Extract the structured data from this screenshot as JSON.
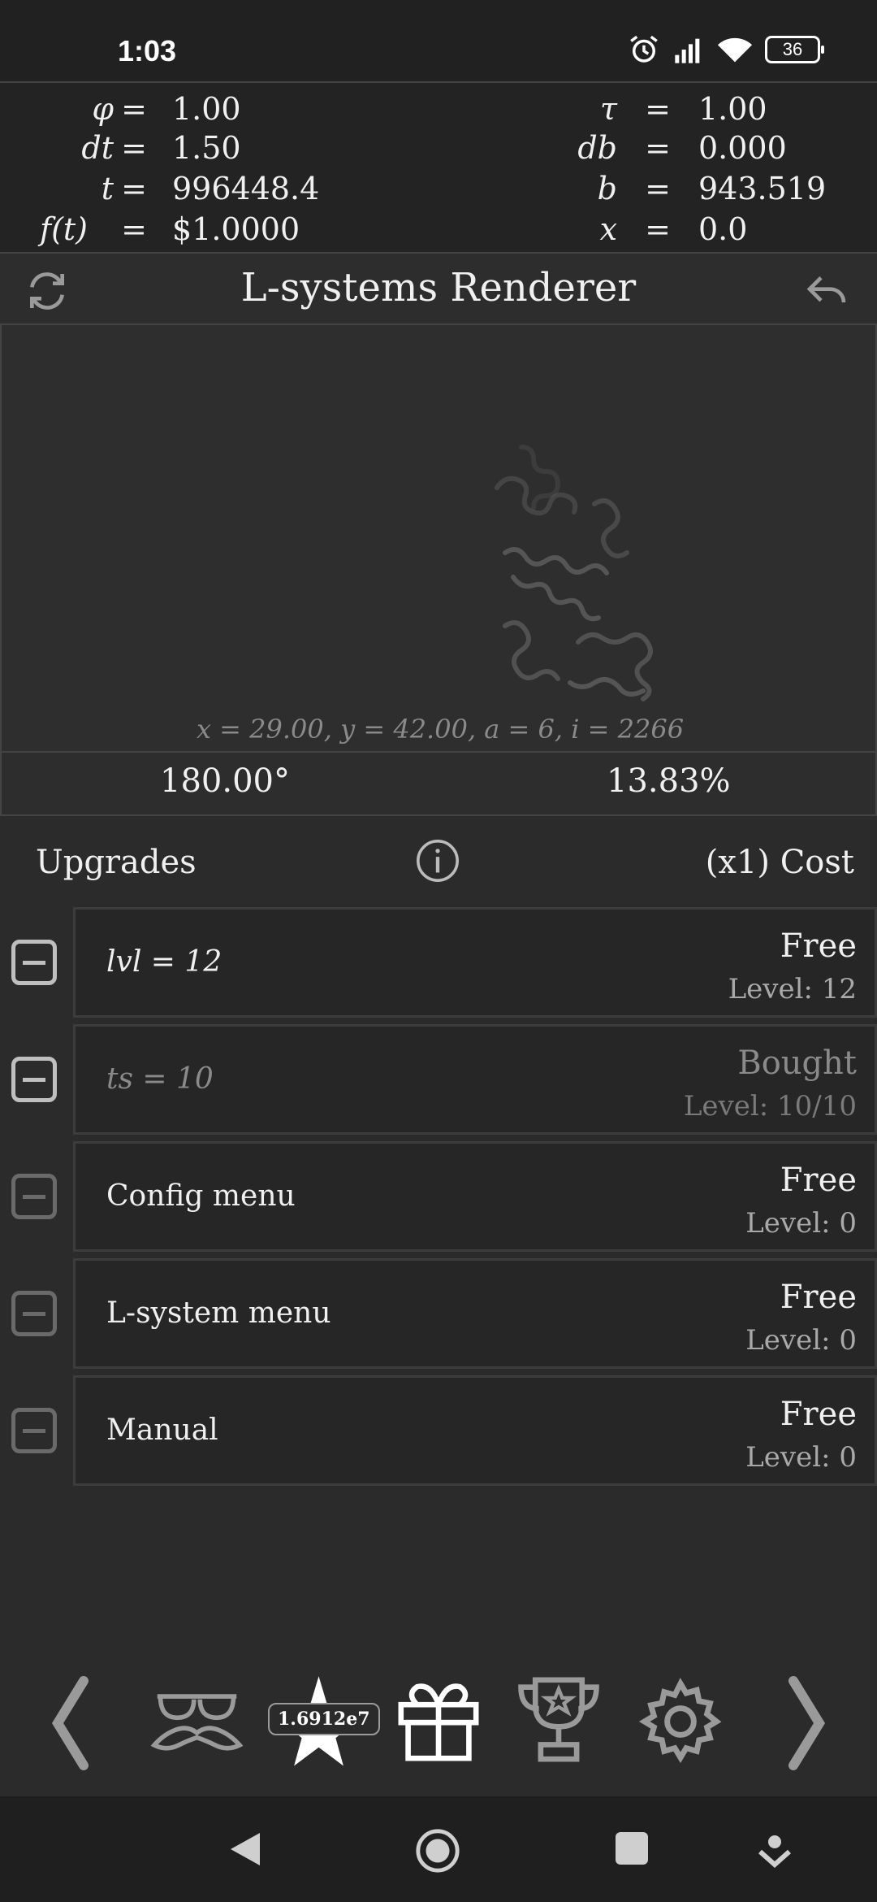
{
  "status_bar": {
    "time": "1:03",
    "battery": "36",
    "icons": [
      "alarm-icon",
      "signal-icon",
      "wifi-icon",
      "battery-icon"
    ]
  },
  "variables": {
    "left": [
      {
        "name": "φ",
        "value": "1.00"
      },
      {
        "name": "dt",
        "value": "1.50"
      },
      {
        "name": "t",
        "value": "996448.4"
      },
      {
        "name": "f(t)",
        "value": "$1.0000"
      }
    ],
    "right": [
      {
        "name": "τ",
        "value": "1.00"
      },
      {
        "name": "db",
        "value": "0.000"
      },
      {
        "name": "b",
        "value": "943.519"
      },
      {
        "name": "x",
        "value": "0.0"
      }
    ],
    "equals": "="
  },
  "title_bar": {
    "title": "L-systems Renderer",
    "left_icon": "refresh-icon",
    "right_icon": "undo-icon"
  },
  "canvas": {
    "coords": "x = 29.00,   y = 42.00,   a = 6,   i = 2266"
  },
  "info_strip": {
    "angle": "180.00°",
    "progress": "13.83%"
  },
  "upgrades_header": {
    "label": "Upgrades",
    "cost_label": "(x1) Cost",
    "info_icon": "info-icon"
  },
  "upgrades": [
    {
      "title": "lvl = 12",
      "cost": "Free",
      "level": "Level: 12"
    },
    {
      "title": "ts = 10",
      "cost": "Bought",
      "level": "Level: 10/10"
    },
    {
      "title": "Config menu",
      "cost": "Free",
      "level": "Level: 0"
    },
    {
      "title": "L-system menu",
      "cost": "Free",
      "level": "Level: 0"
    },
    {
      "title": "Manual",
      "cost": "Free",
      "level": "Level: 0"
    }
  ],
  "bottom_nav": {
    "badge": "1.6912e7",
    "icons": [
      "chevron-left-icon",
      "disguise-icon",
      "star-icon",
      "gift-icon",
      "trophy-icon",
      "settings-icon",
      "chevron-right-icon"
    ]
  },
  "system_nav": {
    "icons": [
      "back-icon",
      "home-icon",
      "recents-icon",
      "assistant-icon"
    ]
  }
}
